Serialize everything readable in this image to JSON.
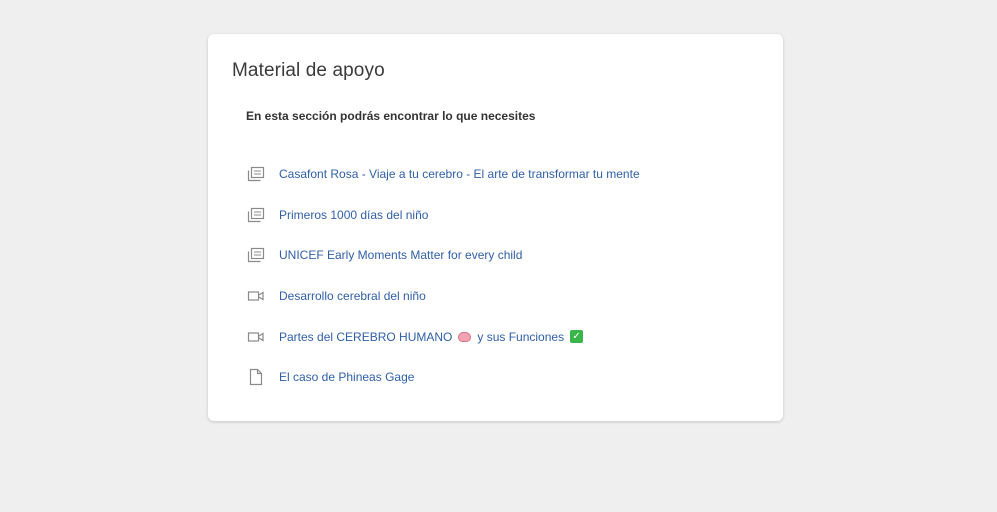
{
  "card": {
    "title": "Material de apoyo",
    "subtitle": "En esta sección podrás encontrar lo que necesites"
  },
  "resources": [
    {
      "icon": "book-icon",
      "label": "Casafont Rosa - Viaje a tu cerebro - El arte de transformar tu mente"
    },
    {
      "icon": "book-icon",
      "label": "Primeros 1000 días del niño"
    },
    {
      "icon": "book-icon",
      "label": "UNICEF Early Moments Matter for every child"
    },
    {
      "icon": "video-icon",
      "label": "Desarrollo cerebral del niño"
    },
    {
      "icon": "video-icon",
      "label_before": "Partes del CEREBRO HUMANO",
      "label_after": "y sus Funciones",
      "emojis": [
        "brain-emoji",
        "check-mark-emoji"
      ]
    },
    {
      "icon": "file-icon",
      "label": "El caso de Phineas Gage"
    }
  ],
  "colors": {
    "background": "#efefef",
    "card": "#ffffff",
    "link": "#2f5fa8",
    "icon": "#8a8a8a"
  }
}
